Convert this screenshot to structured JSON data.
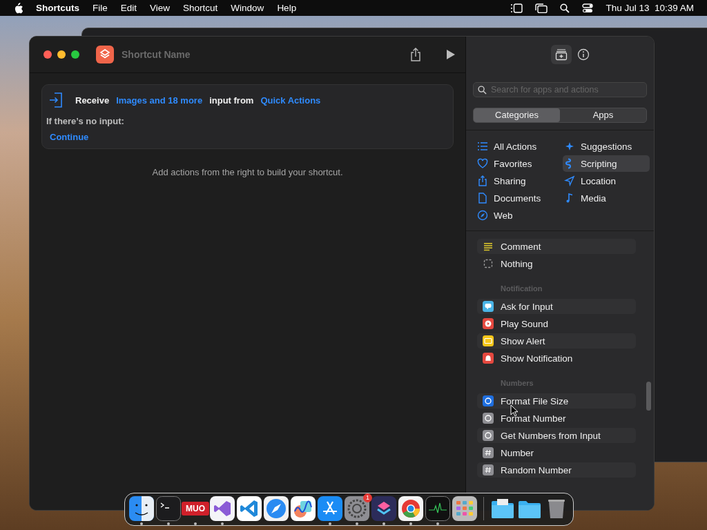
{
  "menu_bar": {
    "app": "Shortcuts",
    "menus": [
      "File",
      "Edit",
      "View",
      "Shortcut",
      "Window",
      "Help"
    ],
    "clock": "Thu Jul 13  10:39 AM"
  },
  "window": {
    "title": "Shortcut Name",
    "receive": {
      "label": "Receive",
      "types": "Images and 18 more",
      "middle": "input from",
      "source": "Quick Actions",
      "no_input_label": "If there’s no input:",
      "no_input_action": "Continue"
    },
    "hint": "Add actions from the right to build your shortcut."
  },
  "library": {
    "search": {
      "placeholder": "Search for apps and actions"
    },
    "tabs": [
      {
        "label": "Categories",
        "selected": true
      },
      {
        "label": "Apps",
        "selected": false
      }
    ],
    "categories": [
      {
        "label": "All Actions",
        "selected": false
      },
      {
        "label": "Suggestions",
        "selected": false
      },
      {
        "label": "Favorites",
        "selected": false
      },
      {
        "label": "Scripting",
        "selected": true
      },
      {
        "label": "Sharing",
        "selected": false
      },
      {
        "label": "Location",
        "selected": false
      },
      {
        "label": "Documents",
        "selected": false
      },
      {
        "label": "Media",
        "selected": false
      },
      {
        "label": "Web",
        "selected": false
      }
    ],
    "sections": [
      {
        "items": [
          {
            "label": "Comment",
            "color": "#d8c22c"
          },
          {
            "label": "Nothing",
            "color": "#9a9a9a"
          }
        ]
      },
      {
        "title": "Notification",
        "items": [
          {
            "label": "Ask for Input",
            "color": "#4ab4e6"
          },
          {
            "label": "Play Sound",
            "color": "#e5483f"
          },
          {
            "label": "Show Alert",
            "color": "#f5c518"
          },
          {
            "label": "Show Notification",
            "color": "#e5483f"
          }
        ]
      },
      {
        "title": "Numbers",
        "items": [
          {
            "label": "Format File Size",
            "color": "#1f6fe0"
          },
          {
            "label": "Format Number",
            "color": "#8e8e93"
          },
          {
            "label": "Get Numbers from Input",
            "color": "#8e8e93"
          },
          {
            "label": "Number",
            "color": "#8e8e93"
          },
          {
            "label": "Random Number",
            "color": "#8e8e93"
          }
        ]
      }
    ]
  },
  "dock": [
    {
      "kind": "finder",
      "running": true
    },
    {
      "kind": "terminal",
      "running": true
    },
    {
      "kind": "muo",
      "text": "MUO",
      "running": true
    },
    {
      "kind": "vs",
      "running": true
    },
    {
      "kind": "vscode",
      "running": false
    },
    {
      "kind": "safari",
      "running": false
    },
    {
      "kind": "freeform",
      "running": false
    },
    {
      "kind": "appstore",
      "running": true
    },
    {
      "kind": "settings",
      "running": true,
      "badge": "1"
    },
    {
      "kind": "shortcuts",
      "running": true
    },
    {
      "kind": "chrome",
      "running": true
    },
    {
      "kind": "monitor",
      "running": true
    },
    {
      "kind": "launchpad",
      "running": false
    },
    {
      "kind": "separator"
    },
    {
      "kind": "folder-docs",
      "running": false
    },
    {
      "kind": "folder",
      "running": false
    },
    {
      "kind": "trash",
      "running": false
    }
  ]
}
